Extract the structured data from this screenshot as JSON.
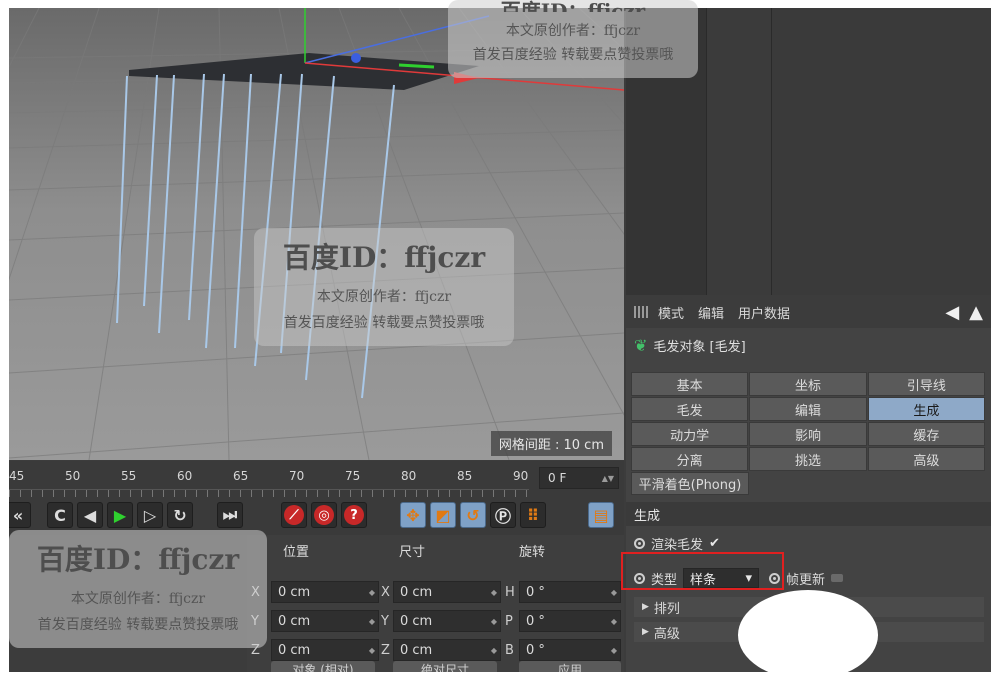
{
  "viewport": {
    "grid_distance_text": "网格间距 : 10 cm"
  },
  "timeline": {
    "ticks": [
      "45",
      "50",
      "55",
      "60",
      "65",
      "70",
      "75",
      "80",
      "85",
      "90"
    ],
    "current_frame": "0 F"
  },
  "coords": {
    "headers": {
      "position": "位置",
      "size": "尺寸",
      "rotation": "旋转"
    },
    "position": [
      {
        "axis": "X",
        "value": "0 cm"
      },
      {
        "axis": "Y",
        "value": "0 cm"
      },
      {
        "axis": "Z",
        "value": "0 cm"
      }
    ],
    "size": [
      {
        "axis": "X",
        "value": "0 cm"
      },
      {
        "axis": "Y",
        "value": "0 cm"
      },
      {
        "axis": "Z",
        "value": "0 cm"
      }
    ],
    "rotation": [
      {
        "axis": "H",
        "value": "0 °"
      },
      {
        "axis": "P",
        "value": "0 °"
      },
      {
        "axis": "B",
        "value": "0 °"
      }
    ],
    "object_mode_label": "对象 (相对)",
    "size_mode_label": "绝对尺寸",
    "apply_label": "应用"
  },
  "attributes": {
    "menu": [
      "模式",
      "编辑",
      "用户数据"
    ],
    "object_title": "毛发对象 [毛发]",
    "tabs": [
      [
        "基本",
        "坐标",
        "引导线"
      ],
      [
        "毛发",
        "编辑",
        "生成"
      ],
      [
        "动力学",
        "影响",
        "缓存"
      ],
      [
        "分离",
        "挑选",
        "高级"
      ]
    ],
    "active_tab": "生成",
    "phong_label": "平滑着色(Phong)",
    "section_title": "生成",
    "render_hair_label": "渲染毛发",
    "render_hair_check": "✔",
    "type_label": "类型",
    "type_value": "样条",
    "frame_update_label": "帧更新",
    "subsections": [
      "排列",
      "高级"
    ]
  },
  "watermarks": {
    "title": "百度ID：ffjczr",
    "line1": "本文原创作者：ffjczr",
    "line2": "首发百度经验 转载要点赞投票哦"
  },
  "colors": {
    "active_tab": "#8ea9c8",
    "highlight_box": "#e02020",
    "hair_strands": "#a9c8e8"
  }
}
